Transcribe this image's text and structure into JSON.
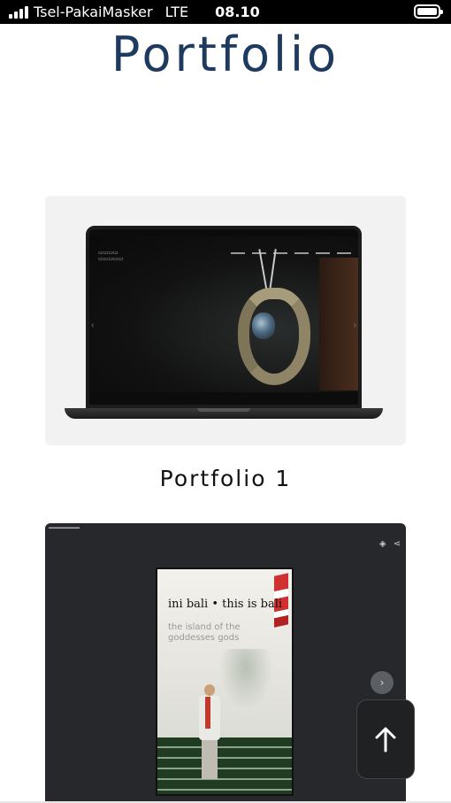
{
  "status_bar": {
    "carrier": "Tsel-PakaiMasker",
    "network": "LTE",
    "time": "08.10"
  },
  "page": {
    "title": "Portfolio"
  },
  "portfolio_items": [
    {
      "label": "Portfolio 1"
    }
  ],
  "preview2": {
    "heading": "ini bali • this is bali",
    "subtitle": "the island of the goddesses gods"
  },
  "icons": {
    "carousel_next": "chevron-right-icon",
    "scroll_to_top": "arrow-up-icon"
  }
}
